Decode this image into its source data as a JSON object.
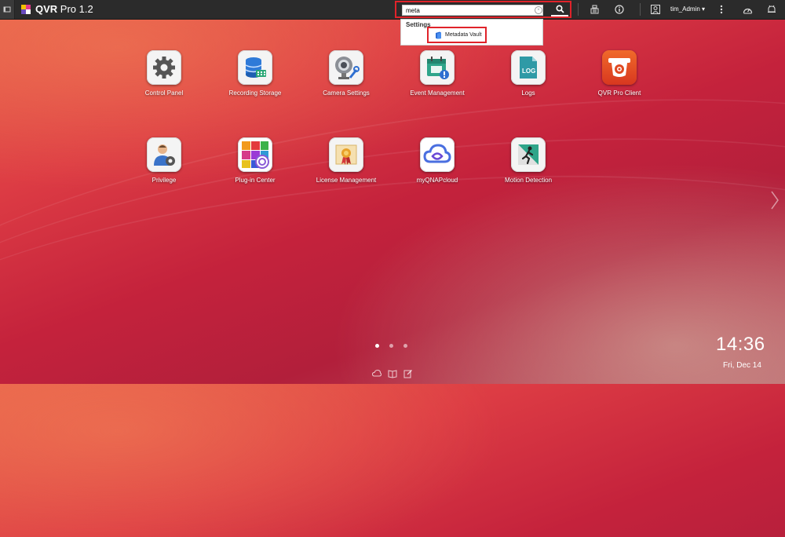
{
  "topbar": {
    "app_name": "QVR",
    "app_version": "Pro 1.2",
    "user_name": "tim_Admin",
    "icons": [
      "menu-icon",
      "search-icon",
      "tasks-icon",
      "info-icon",
      "user-icon",
      "more-icon",
      "dashboard-icon",
      "notification-icon"
    ]
  },
  "search": {
    "value": "meta",
    "results": {
      "heading": "Settings",
      "items": [
        {
          "label": "Metadata Vault",
          "icon": "metadata-vault-icon"
        }
      ]
    }
  },
  "apps": [
    {
      "label": "Control Panel",
      "icon": "gear-icon"
    },
    {
      "label": "Recording Storage",
      "icon": "storage-icon"
    },
    {
      "label": "Camera Settings",
      "icon": "camera-settings-icon"
    },
    {
      "label": "Event Management",
      "icon": "event-calendar-icon"
    },
    {
      "label": "Logs",
      "icon": "log-icon"
    },
    {
      "label": "QVR Pro Client",
      "icon": "qvr-client-icon"
    },
    {
      "label": "Privilege",
      "icon": "privilege-icon"
    },
    {
      "label": "Plug-in Center",
      "icon": "plugin-icon"
    },
    {
      "label": "License Management",
      "icon": "license-icon"
    },
    {
      "label": "myQNAPcloud",
      "icon": "cloud-icon"
    },
    {
      "label": "Motion Detection",
      "icon": "motion-detection-icon"
    }
  ],
  "pagination": {
    "total": 3,
    "current": 1
  },
  "clock": {
    "time": "14:36",
    "date": "Fri, Dec 14"
  },
  "colors": {
    "accent": "#e0232a",
    "topbar": "#2b2b2b"
  }
}
